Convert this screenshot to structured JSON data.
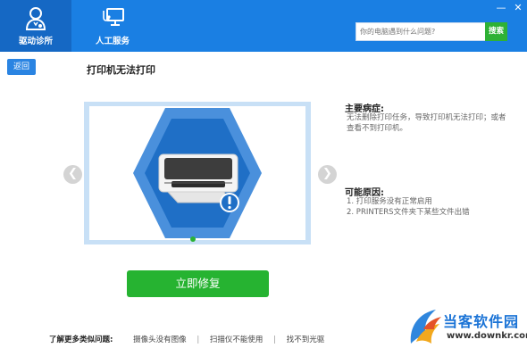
{
  "nav": {
    "tabs": [
      {
        "label": "驱动诊所",
        "icon": "doctor-icon",
        "active": true
      },
      {
        "label": "人工服务",
        "icon": "monitor-stethoscope-icon",
        "active": false
      }
    ]
  },
  "window": {
    "minimize": "—",
    "close": "✕"
  },
  "search": {
    "placeholder": "你的电脑遇到什么问题?",
    "button_label": "搜索"
  },
  "back_button": "返回",
  "page_title": "打印机无法打印",
  "carousel": {
    "prev": "❮",
    "next": "❯",
    "image": "printer-error-illustration",
    "slide_count": 1,
    "active_slide": 1
  },
  "symptom": {
    "heading": "主要病症:",
    "text": "无法删除打印任务，导致打印机无法打印；或者查看不到打印机。"
  },
  "causes": {
    "heading": "可能原因:",
    "items": [
      "1. 打印服务没有正常启用",
      "2. PRINTERS文件夹下某些文件出错"
    ]
  },
  "fix_button": "立即修复",
  "related": {
    "label": "了解更多类似问题:",
    "links": [
      "摄像头没有图像",
      "扫描仪不能使用",
      "找不到光驱"
    ]
  },
  "watermark": {
    "text": "当客软件园",
    "url": "www.downkr.com"
  },
  "colors": {
    "header": "#1a7fe3",
    "accent_green": "#26b331",
    "hex_outer": "#4a90dc",
    "hex_inner": "#1f6fc6"
  }
}
